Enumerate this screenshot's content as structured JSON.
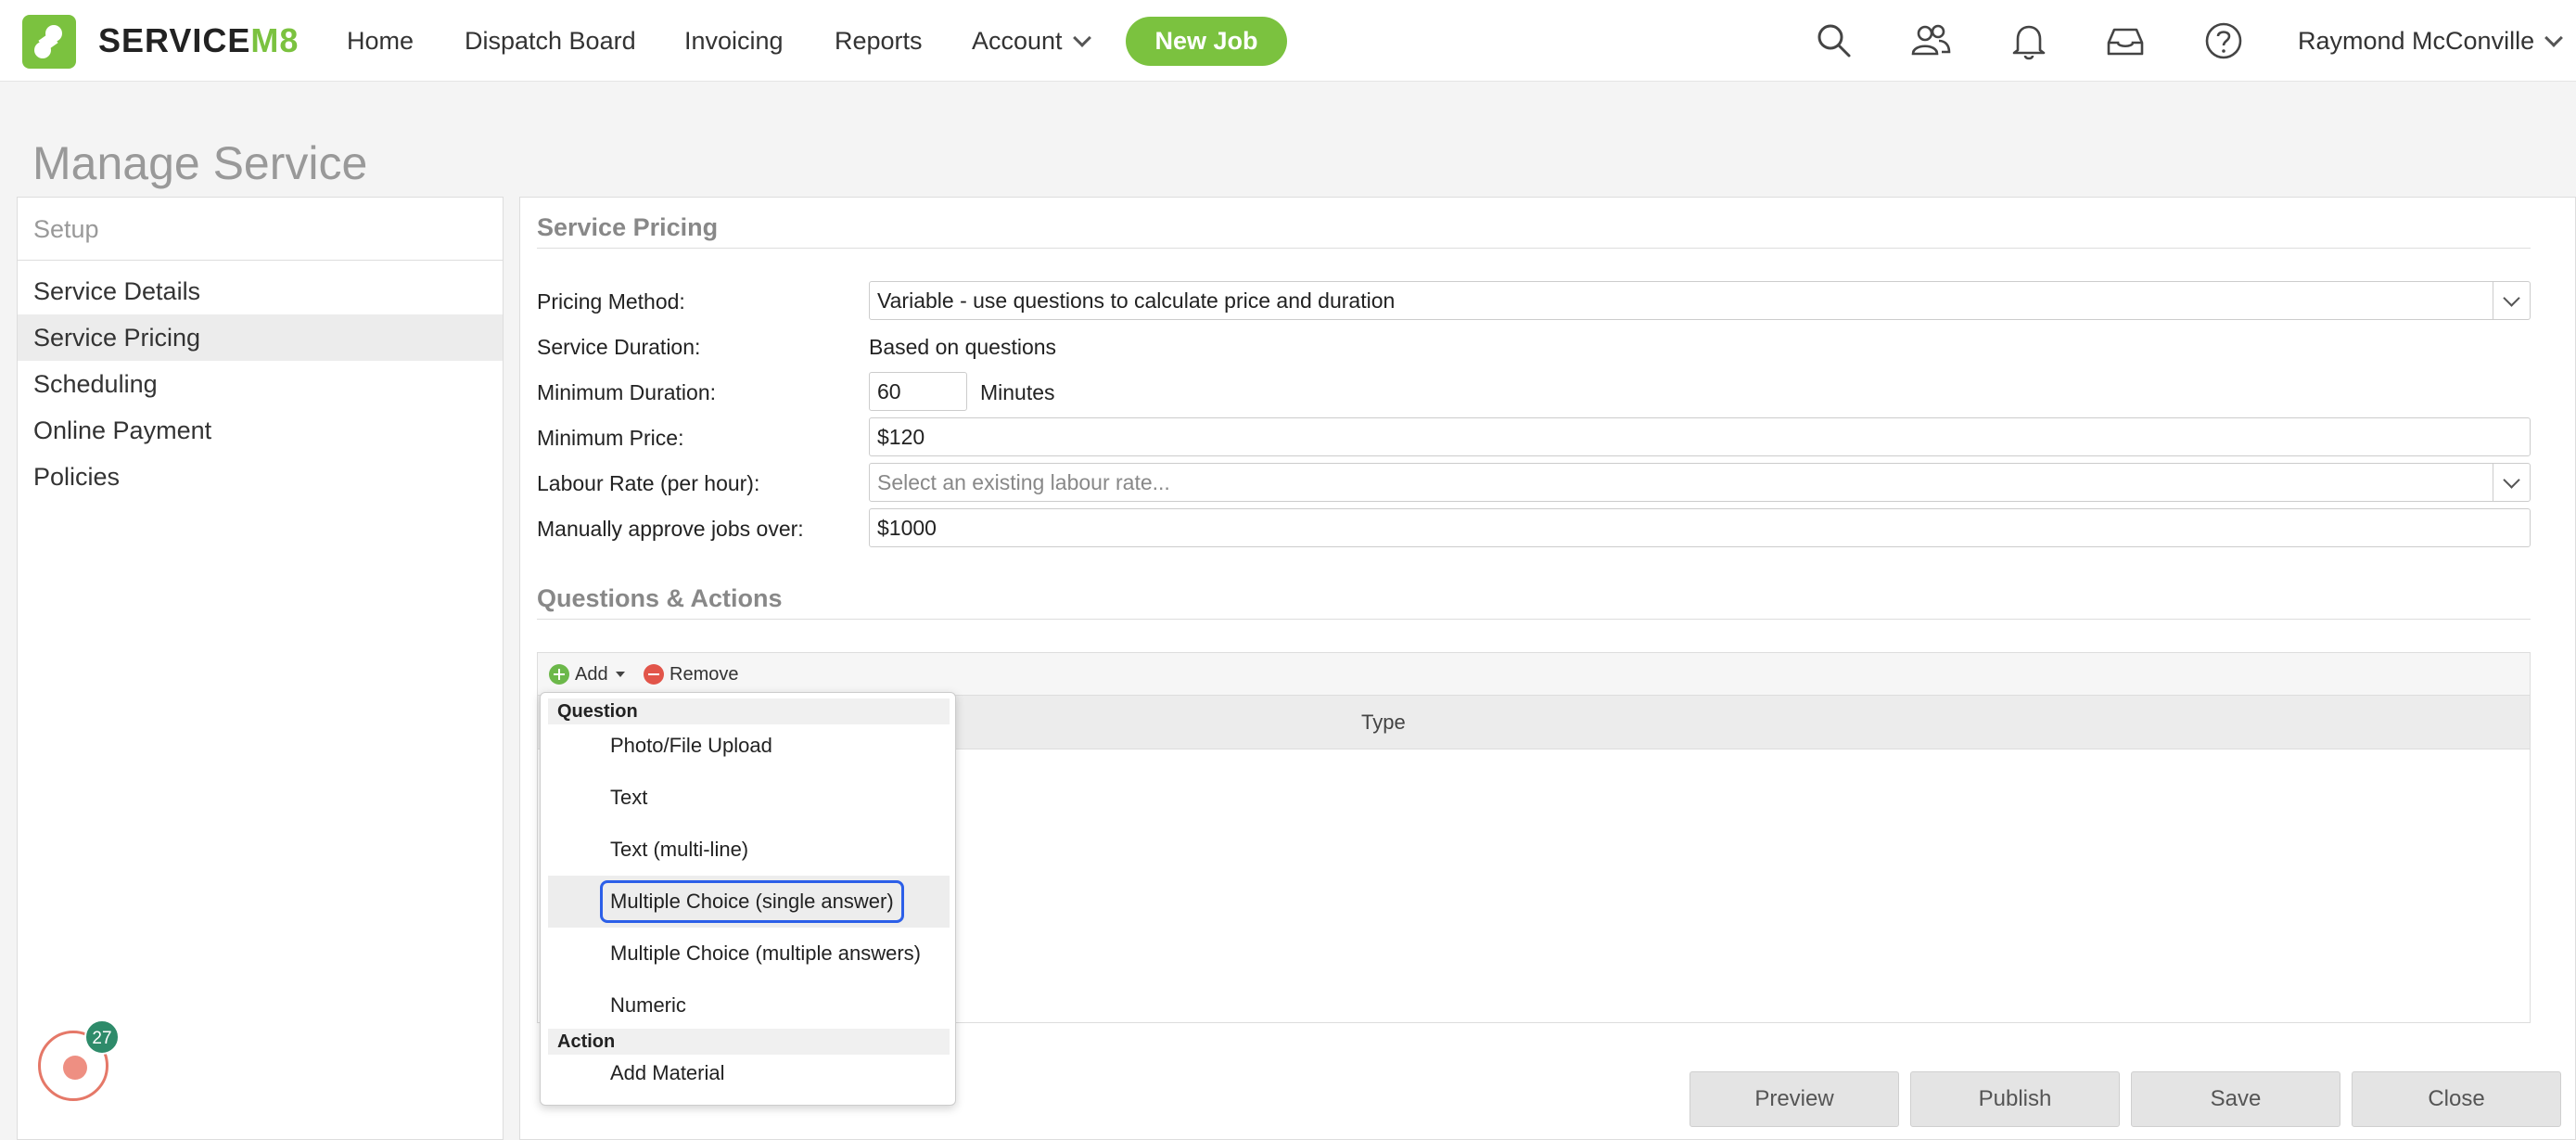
{
  "nav": {
    "brand_prefix": "SERVICE",
    "brand_suffix": "M8",
    "links": [
      "Home",
      "Dispatch Board",
      "Invoicing",
      "Reports",
      "Account"
    ],
    "new_job": "New Job",
    "icons": [
      "search-icon",
      "people-icon",
      "bell-icon",
      "inbox-icon",
      "help-icon"
    ],
    "user": "Raymond McConville",
    "accent": "#7bc23f"
  },
  "page": {
    "title": "Manage Service"
  },
  "sidebar": {
    "header": "Setup",
    "items": [
      "Service Details",
      "Service Pricing",
      "Scheduling",
      "Online Payment",
      "Policies"
    ],
    "active": "Service Pricing",
    "badge_count": "27"
  },
  "pricing": {
    "title": "Service Pricing",
    "method_label": "Pricing Method:",
    "method_value": "Variable - use questions to calculate price and duration",
    "duration_label": "Service Duration:",
    "duration_value": "Based on questions",
    "min_duration_label": "Minimum Duration:",
    "min_duration_value": "60",
    "min_duration_unit": "Minutes",
    "min_price_label": "Minimum Price:",
    "min_price_value": "$120",
    "labour_label": "Labour Rate (per hour):",
    "labour_placeholder": "Select an existing labour rate...",
    "approve_label": "Manually approve jobs over:",
    "approve_value": "$1000"
  },
  "questions": {
    "title": "Questions & Actions",
    "add": "Add",
    "remove": "Remove",
    "col_type": "Type"
  },
  "menu": {
    "question_group": "Question",
    "question_items": [
      "Photo/File Upload",
      "Text",
      "Text (multi-line)",
      "Multiple Choice (single answer)",
      "Multiple Choice (multiple answers)",
      "Numeric"
    ],
    "action_group": "Action",
    "action_items": [
      "Add Material"
    ]
  },
  "footer": {
    "buttons": [
      "Preview",
      "Publish",
      "Save",
      "Close"
    ]
  }
}
